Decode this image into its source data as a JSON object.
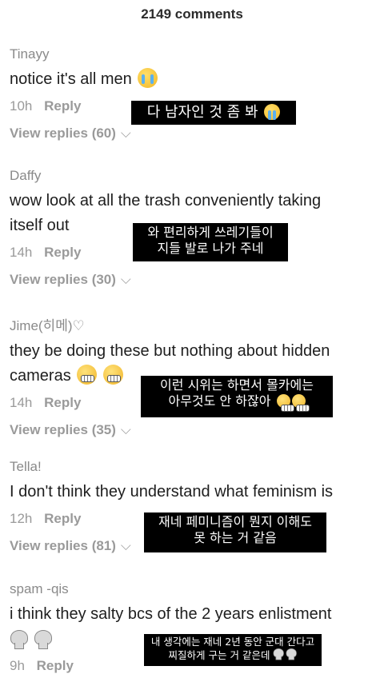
{
  "header": {
    "title": "2149 comments"
  },
  "comments": [
    {
      "author": "Tinayy",
      "text": "notice it's all men",
      "time": "10h",
      "reply": "Reply",
      "view_replies": "View replies (60)",
      "translation": "다 남자인 것 좀 봐"
    },
    {
      "author": "Daffy",
      "text_line1": "wow look at all the trash conveniently taking",
      "text_line2": "itself out",
      "time": "14h",
      "reply": "Reply",
      "view_replies": "View replies (30)",
      "translation_line1": "와 편리하게 쓰레기들이",
      "translation_line2": "지들 발로 나가 주네"
    },
    {
      "author": "Jime(히메)♡",
      "text_line1": "they be doing these but nothing about hidden",
      "text_line2": "cameras",
      "time": "14h",
      "reply": "Reply",
      "view_replies": "View replies (35)",
      "translation_line1": "이런 시위는 하면서 몰카에는",
      "translation_line2": "아무것도 안 하잖아"
    },
    {
      "author": "Tella!",
      "text": "I don't think they understand what feminism is",
      "time": "12h",
      "reply": "Reply",
      "view_replies": "View replies (81)",
      "translation_line1": "재네 페미니즘이 뭔지 이해도",
      "translation_line2": "못 하는 거 같음"
    },
    {
      "author": "spam -qis",
      "text": "i think they salty bcs of the 2 years enlistment",
      "time": "9h",
      "reply": "Reply",
      "translation_line1": "내 생각에는 재네 2년 동안 군대 간다고",
      "translation_line2": "찌질하게 구는 거 같은데"
    }
  ],
  "icons": {
    "chevron": "chevron-down-icon",
    "sob": "loudly-crying-face-icon",
    "grimace": "grimacing-face-icon",
    "skull": "skull-icon"
  }
}
